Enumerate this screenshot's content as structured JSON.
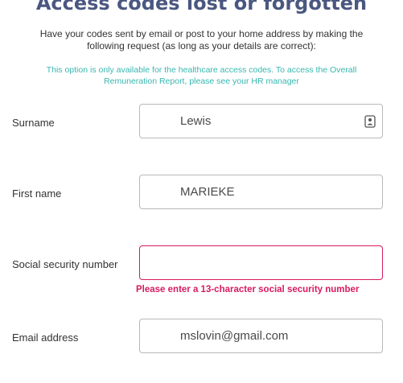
{
  "header": {
    "title": "Access codes lost or forgotten",
    "intro": "Have your codes sent by email or post to your home address by making the following request (as long as your details are correct):",
    "note": "This option is only available for the healthcare access codes. To access the Overall Remuneration Report, please see your HR manager"
  },
  "form": {
    "surname": {
      "label": "Surname",
      "value": "Lewis",
      "icon": "contact-card-icon"
    },
    "first_name": {
      "label": "First name",
      "value": "MARIEKE"
    },
    "ssn": {
      "label": "Social security number",
      "value": "",
      "error": "Please enter a 13-character social security number"
    },
    "email": {
      "label": "Email address",
      "value": "mslovin@gmail.com"
    }
  },
  "colors": {
    "title": "#4a5780",
    "note": "#37b7b0",
    "error": "#d81b60",
    "border": "#b8b8b8"
  }
}
